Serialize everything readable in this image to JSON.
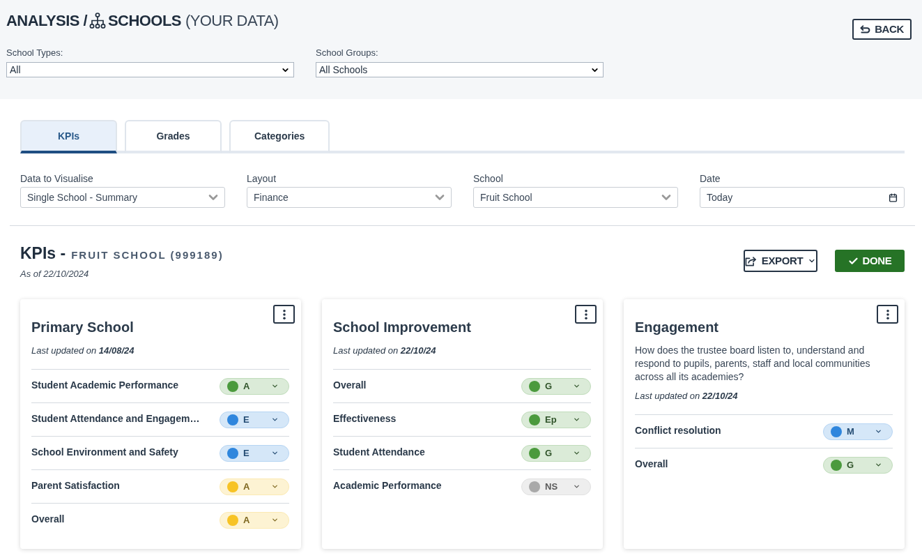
{
  "header": {
    "section": "ANALYSIS /",
    "page": "SCHOOLS",
    "note": "(YOUR DATA)",
    "back_button": "BACK"
  },
  "filters": [
    {
      "label": "School Types:",
      "value": "All"
    },
    {
      "label": "School Groups:",
      "value": "All Schools"
    }
  ],
  "tabs": [
    {
      "label": "KPIs",
      "selected": true
    },
    {
      "label": "Grades",
      "selected": false
    },
    {
      "label": "Categories",
      "selected": false
    }
  ],
  "options": [
    {
      "kind": "select",
      "label": "Data to Visualise",
      "value": "Single School - Summary"
    },
    {
      "kind": "select",
      "label": "Layout",
      "value": "Finance"
    },
    {
      "kind": "select",
      "label": "School",
      "value": "Fruit School"
    },
    {
      "kind": "date",
      "label": "Date",
      "value": "Today"
    }
  ],
  "report": {
    "title": "KPIs -",
    "school": "FRUIT SCHOOL (999189)",
    "as_of": "As of 22/10/2024",
    "export_button": "EXPORT",
    "done_button": "DONE"
  },
  "cards": [
    {
      "title": "Primary School",
      "updated": "Last updated on **14/08/24**",
      "kpis": [
        {
          "label": "Student Academic Performance",
          "status": "A",
          "color": "#4b9a3d"
        },
        {
          "label": "Student Attendance and Engagem…",
          "status": "E",
          "color": "#2f86dd"
        },
        {
          "label": "School Environment and Safety",
          "status": "E",
          "color": "#2f86dd"
        },
        {
          "label": "Parent Satisfaction",
          "status": "A",
          "color": "#f7c325"
        },
        {
          "label": "Overall",
          "status": "A",
          "color": "#f7c325"
        }
      ]
    },
    {
      "title": "School Improvement",
      "updated": "Last updated on **22/10/24**",
      "kpis": [
        {
          "label": "Overall",
          "status": "G",
          "color": "#4b9a3d"
        },
        {
          "label": "Effectiveness",
          "status": "Ep",
          "color": "#4b9a3d"
        },
        {
          "label": "Student Attendance",
          "status": "G",
          "color": "#4b9a3d"
        },
        {
          "label": "Academic Performance",
          "status": "NS",
          "color": "#a9a9a9"
        }
      ]
    },
    {
      "title": "Engagement",
      "description": "How does the trustee board listen to, understand and respond to pupils, parents, staff and local communities across all its academies?",
      "updated": "Last updated on **22/10/24**",
      "kpis": [
        {
          "label": "Conflict resolution",
          "status": "M",
          "color": "#2f86dd"
        },
        {
          "label": "Overall",
          "status": "G",
          "color": "#4b9a3d"
        }
      ]
    }
  ]
}
